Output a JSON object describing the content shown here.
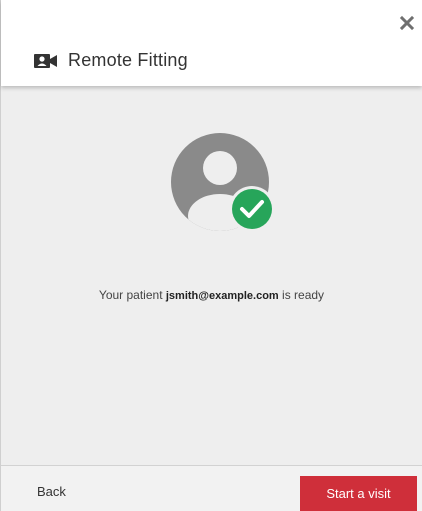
{
  "dialog": {
    "title": "Remote Fitting",
    "title_icon": "video-camera-icon",
    "close_icon": "close-icon"
  },
  "main": {
    "avatar_icon": "user-avatar-icon",
    "status_icon": "checkmark-icon",
    "status_color": "#27a55a",
    "message_prefix": "Your patient ",
    "patient_email": "jsmith@example.com",
    "message_suffix": " is ready"
  },
  "footer": {
    "back_label": "Back",
    "start_label": "Start a visit",
    "start_color": "#cf2f3a"
  }
}
